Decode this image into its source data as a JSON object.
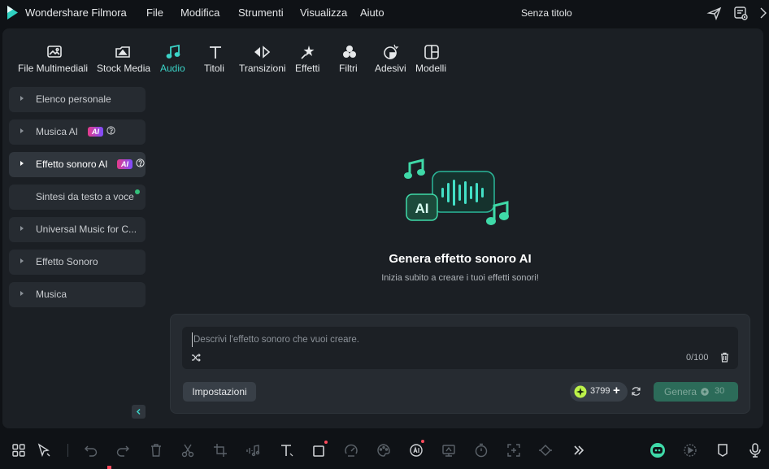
{
  "titlebar": {
    "app_name": "Wondershare Filmora",
    "menu": [
      "File",
      "Modifica",
      "Strumenti",
      "Visualizza",
      "Aiuto"
    ],
    "document_title": "Senza titolo",
    "icons": [
      "send-icon",
      "cloud-menu-icon",
      "more-icon"
    ]
  },
  "toolbar": {
    "tabs": [
      {
        "label": "File Multimediali",
        "icon": "media-icon"
      },
      {
        "label": "Stock Media",
        "icon": "stock-media-icon"
      },
      {
        "label": "Audio",
        "icon": "music-note-icon",
        "active": true
      },
      {
        "label": "Titoli",
        "icon": "titles-icon"
      },
      {
        "label": "Transizioni",
        "icon": "transitions-icon"
      },
      {
        "label": "Effetti",
        "icon": "effects-icon"
      },
      {
        "label": "Filtri",
        "icon": "filters-icon"
      },
      {
        "label": "Adesivi",
        "icon": "stickers-icon"
      },
      {
        "label": "Modelli",
        "icon": "templates-icon"
      }
    ],
    "accent_color": "#3bd3c7"
  },
  "sidebar": {
    "items": [
      {
        "label": "Elenco personale"
      },
      {
        "label": "Musica AI",
        "badge": "AI"
      },
      {
        "label": "Effetto sonoro AI",
        "badge": "AI",
        "active": true
      },
      {
        "label": "Sintesi da testo a voce",
        "new_dot": true
      },
      {
        "label": "Universal Music for C..."
      },
      {
        "label": "Effetto Sonoro"
      },
      {
        "label": "Musica"
      }
    ]
  },
  "content": {
    "illustration_text": "AI",
    "empty_title": "Genera effetto sonoro AI",
    "empty_subtitle": "Inizia subito a creare i tuoi effetti sonori!",
    "prompt": {
      "placeholder": "Descrivi l'effetto sonoro che vuoi creare.",
      "value": "",
      "char_count": "0/100"
    },
    "settings_label": "Impostazioni",
    "credits": "3799",
    "credits_plus": "+",
    "generate_label": "Genera",
    "generate_cost": "30"
  },
  "bottombar": {
    "icons": [
      "layout-icon",
      "select-arrow-icon",
      "undo-icon",
      "redo-icon",
      "delete-icon",
      "scissors-icon",
      "crop-icon",
      "audio-edit-icon",
      "text-icon",
      "shape-icon",
      "speed-icon",
      "color-icon",
      "ai-tools-icon",
      "freeze-frame-icon",
      "timer-icon",
      "stabilize-icon",
      "keyframe-icon",
      "more-tools-icon",
      "ai-mate-icon",
      "render-icon",
      "marker-icon",
      "microphone-icon"
    ]
  }
}
